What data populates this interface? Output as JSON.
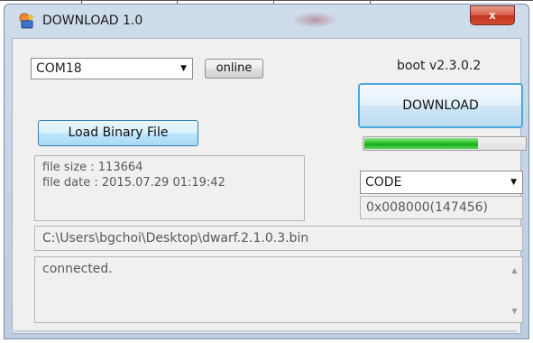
{
  "window": {
    "title": "DOWNLOAD 1.0",
    "close_glyph": "x"
  },
  "port": {
    "selected": "COM18",
    "status_button": "online"
  },
  "boot_version": "boot v2.3.0.2",
  "download_button": "DOWNLOAD",
  "progress": {
    "fraction": 0.71,
    "color": "#22b922"
  },
  "load_button": "Load Binary File",
  "file_info": {
    "size_line": "file size : 113664",
    "date_line": "file date : 2015.07.29 01:19:42"
  },
  "region": {
    "selected": "CODE",
    "address": "0x008000(147456)"
  },
  "file_path": "C:\\Users\\bgchoi\\Desktop\\dwarf.2.1.0.3.bin",
  "log": {
    "text": "connected."
  },
  "icons": {
    "app": "app-icon",
    "close": "close-icon",
    "dropdown": "chevron-down-icon",
    "scroll_up": "scroll-up-icon",
    "scroll_down": "scroll-down-icon"
  }
}
